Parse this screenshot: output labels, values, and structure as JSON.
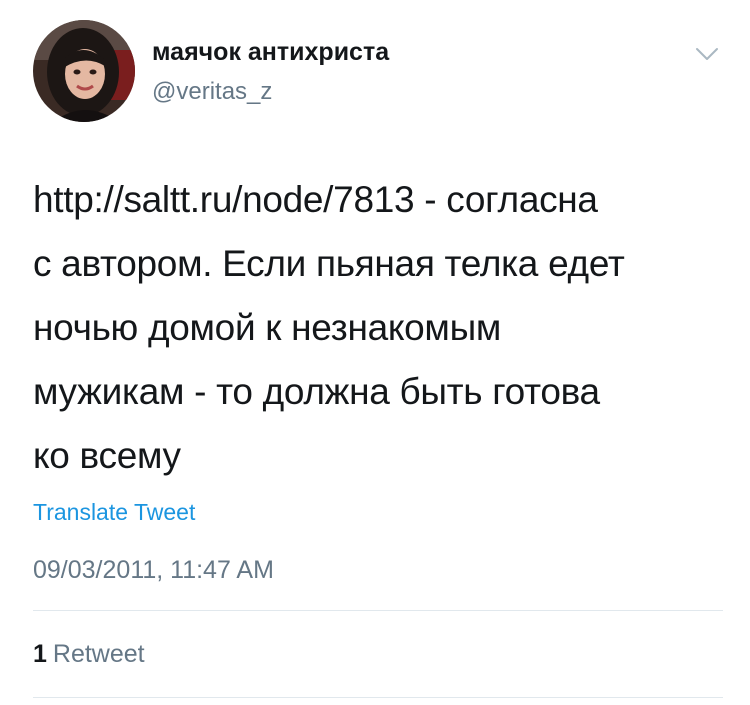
{
  "user": {
    "display_name": "маячок антихриста",
    "handle": "@veritas_z",
    "avatar_icon": "user-avatar"
  },
  "tweet": {
    "text": "http://saltt.ru/node/7813 - согласна\nс автором. Если пьяная телка едет\nночью домой к незнакомым\nмужикам - то должна быть готова\nко всему",
    "translate_label": "Translate Tweet",
    "timestamp": "09/03/2011, 11:47 AM"
  },
  "stats": {
    "retweet_count": "1",
    "retweet_label": "Retweet"
  },
  "colors": {
    "link": "#1b95e0",
    "secondary_text": "#657786",
    "primary_text": "#14171a",
    "divider": "#e1e8ed"
  },
  "icons": {
    "menu": "chevron-down-icon"
  }
}
